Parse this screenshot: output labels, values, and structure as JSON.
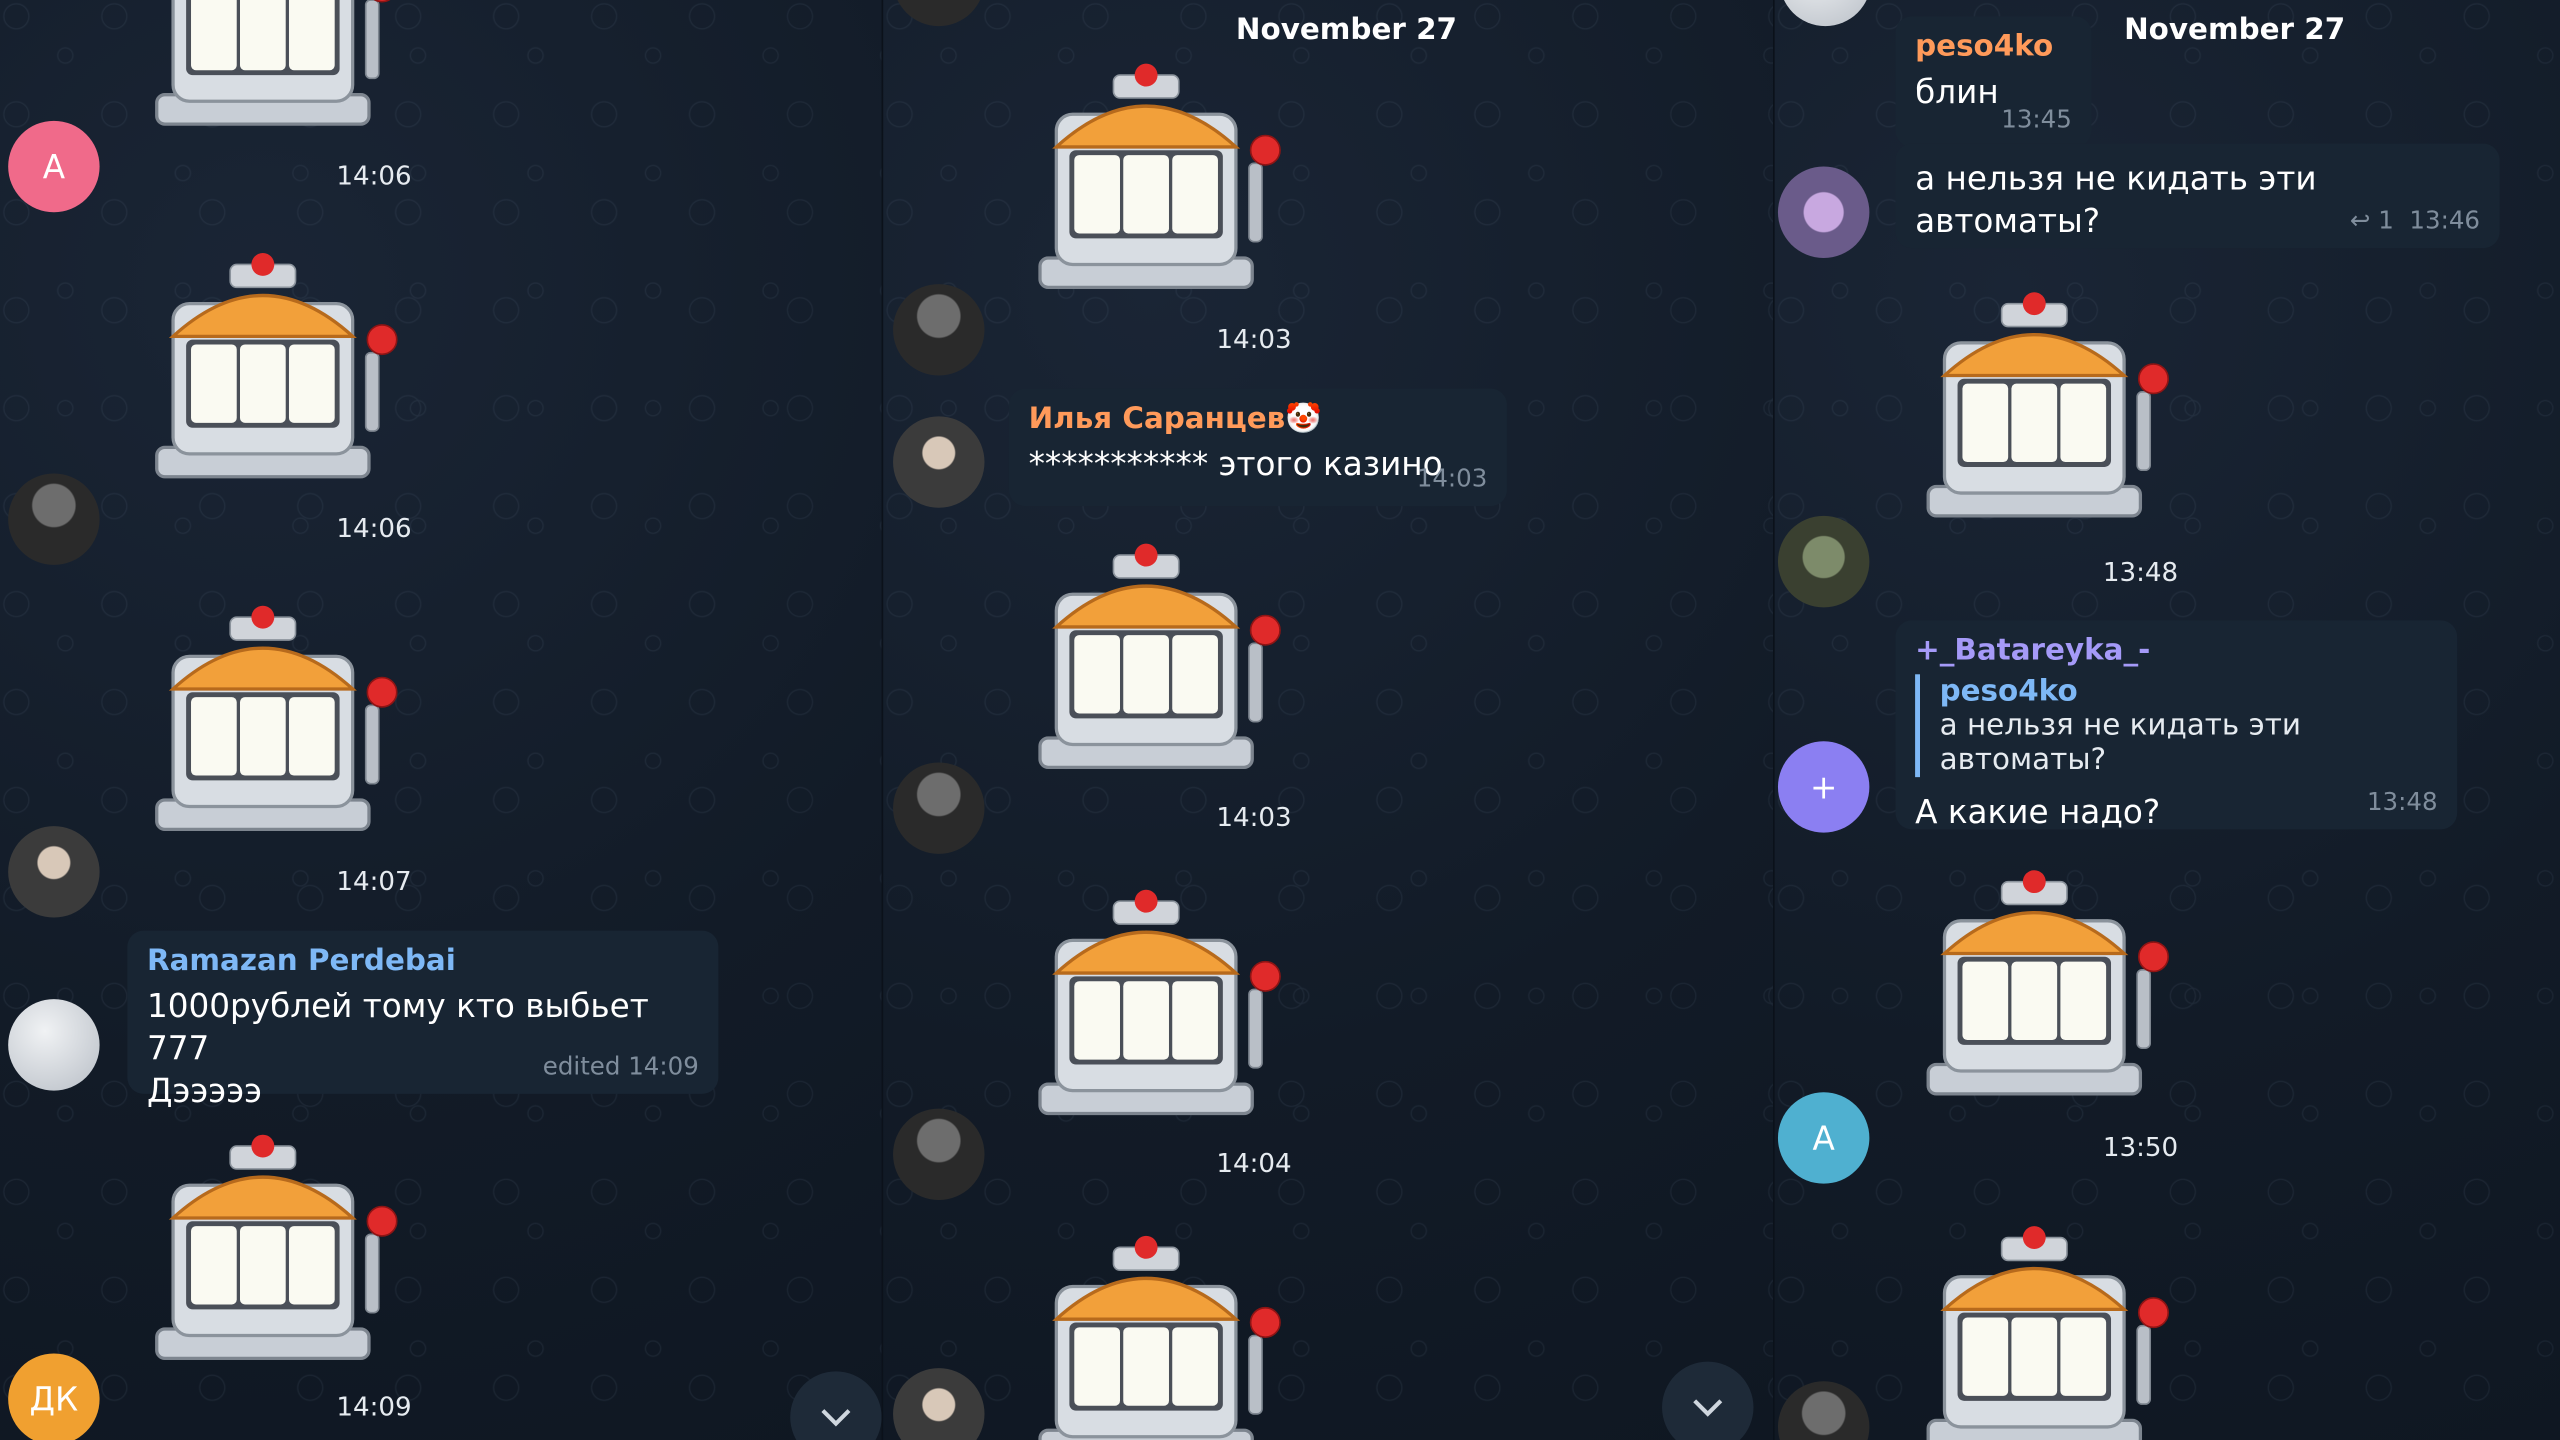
{
  "left_panel": {
    "messages": [
      {
        "time": "14:06"
      },
      {
        "time": "14:06"
      },
      {
        "time": "14:07"
      },
      {
        "author": "Ramazan Perdebai",
        "text": "1000рублей тому кто выбьет 777\nДэээээ",
        "meta": "edited 14:09"
      },
      {
        "time": "14:09"
      }
    ],
    "avatars": [
      {
        "initial": "A",
        "color": "#f06a8a"
      },
      {
        "initial": "",
        "color": ""
      },
      {
        "initial": "",
        "color": ""
      },
      {
        "initial": "",
        "color": ""
      },
      {
        "initial": "ДК",
        "color": "#f0a030"
      }
    ]
  },
  "middle_panel": {
    "date": "November 27",
    "messages": [
      {
        "time": "14:03"
      },
      {
        "author": "Илья Саранцев🤡",
        "text": "*********** этого казино",
        "time": "14:03"
      },
      {
        "time": "14:03"
      },
      {
        "time": "14:04"
      }
    ]
  },
  "right_panel": {
    "date": "November 27",
    "messages": [
      {
        "author": "peso4ko",
        "text": "блин",
        "time": "13:45"
      },
      {
        "text": "а нельзя не кидать эти автоматы?",
        "replies": "1",
        "time": "13:46"
      },
      {
        "time": "13:48"
      },
      {
        "author": "+_Batareyka_-",
        "quote_author": "peso4ko",
        "quote_text": "а нельзя не кидать эти автоматы?",
        "text": "А какие надо?",
        "time": "13:48"
      },
      {
        "time": "13:50"
      }
    ],
    "avatars": [
      {
        "initial": "+",
        "color": "#8b7ff2"
      },
      {
        "initial": "A",
        "color": "#4fb0d0"
      }
    ]
  },
  "colors": {
    "author_orange": "#ff9a5a",
    "author_blue": "#7eb8f6",
    "author_purple": "#a59af8"
  },
  "icons": [
    "slot-machine-icon",
    "chevron-down-icon",
    "reply-icon"
  ]
}
